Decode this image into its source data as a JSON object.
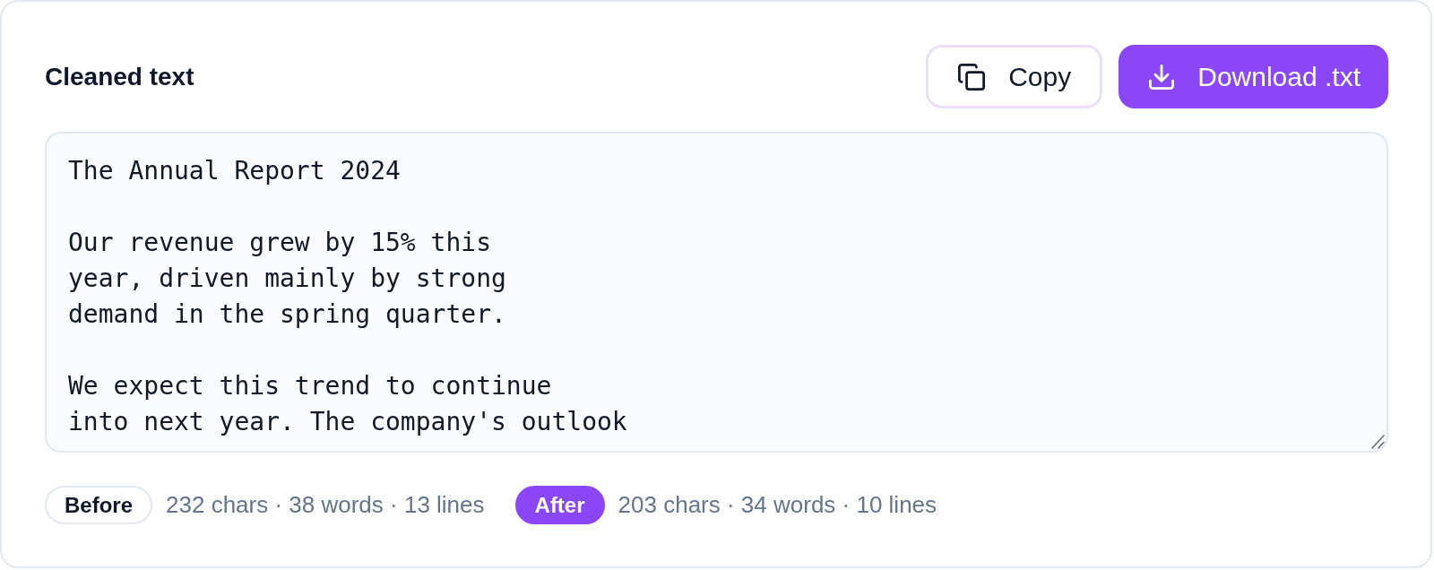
{
  "panel": {
    "title": "Cleaned text",
    "actions": [
      {
        "kind": "copy",
        "label": "Copy"
      },
      {
        "kind": "download",
        "label": "Download .txt"
      }
    ]
  },
  "editor": {
    "text": "The Annual Report 2024\n\nOur revenue grew by 15% this\nyear, driven mainly by strong\ndemand in the spring quarter.\n\nWe expect this trend to continue\ninto next year. The company's outlook"
  },
  "stats": [
    {
      "kind": "outlined",
      "badge": "Before",
      "summary": "232 chars · 38 words · 13 lines"
    },
    {
      "kind": "filled",
      "badge": "After",
      "summary": "203 chars · 34 words · 10 lines"
    }
  ]
}
